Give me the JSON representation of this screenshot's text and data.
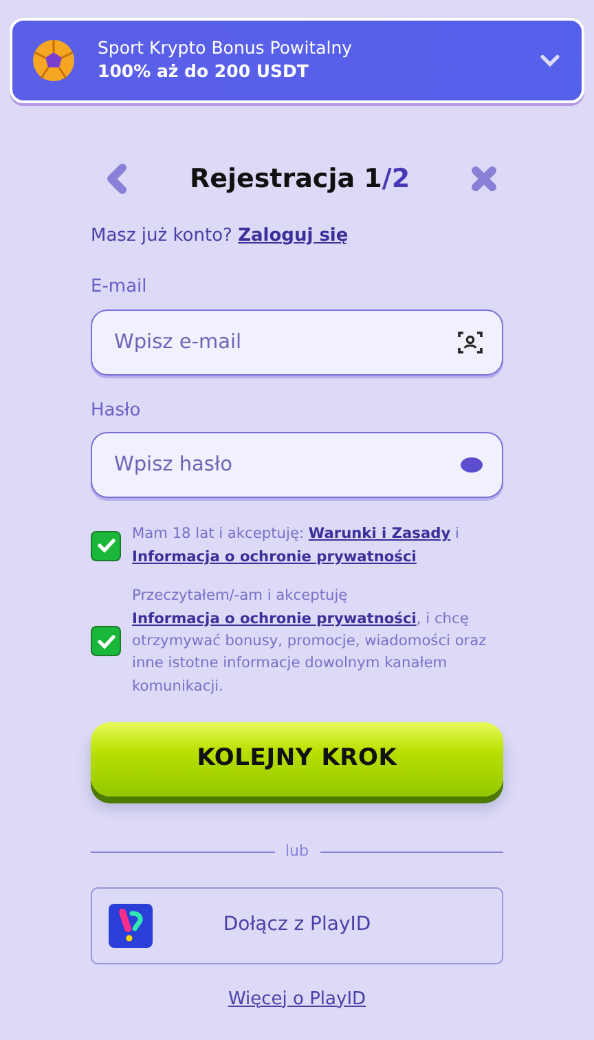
{
  "promo": {
    "title": "Sport Krypto Bonus Powitalny",
    "offer": "100% aż do 200 USDT",
    "expanded": false
  },
  "header": {
    "title_main": "Rejestracja 1",
    "title_accent": "/2"
  },
  "login_prompt": {
    "text": "Masz już konto?",
    "link": "Zaloguj się"
  },
  "fields": [
    {
      "label": "E-mail",
      "placeholder": "Wpisz e-mail",
      "kind": "email"
    },
    {
      "label": "Hasło",
      "placeholder": "Wpisz hasło",
      "kind": "password"
    }
  ],
  "consents": [
    {
      "checked": true,
      "parts": [
        {
          "text": "Mam 18 lat i akceptuję: ",
          "link": false
        },
        {
          "text": "Warunki i Zasady",
          "link": true
        },
        {
          "text": " i ",
          "link": false
        },
        {
          "text": "Informacja o ochronie prywatności",
          "link": true
        }
      ]
    },
    {
      "checked": true,
      "parts": [
        {
          "text": "Przeczytałem/-am i akceptuję ",
          "link": false
        },
        {
          "text": "Informacja o ochronie prywatności",
          "link": true
        },
        {
          "text": ", i chcę otrzymywać bonusy, promocje, wiadomości oraz inne istotne informacje dowolnym kanałem komunikacji.",
          "link": false
        }
      ]
    }
  ],
  "next_button": "KOLEJNY KROK",
  "divider": "lub",
  "playid_button": "Dołącz z PlayID",
  "playid_link": "Więcej o PlayID"
}
